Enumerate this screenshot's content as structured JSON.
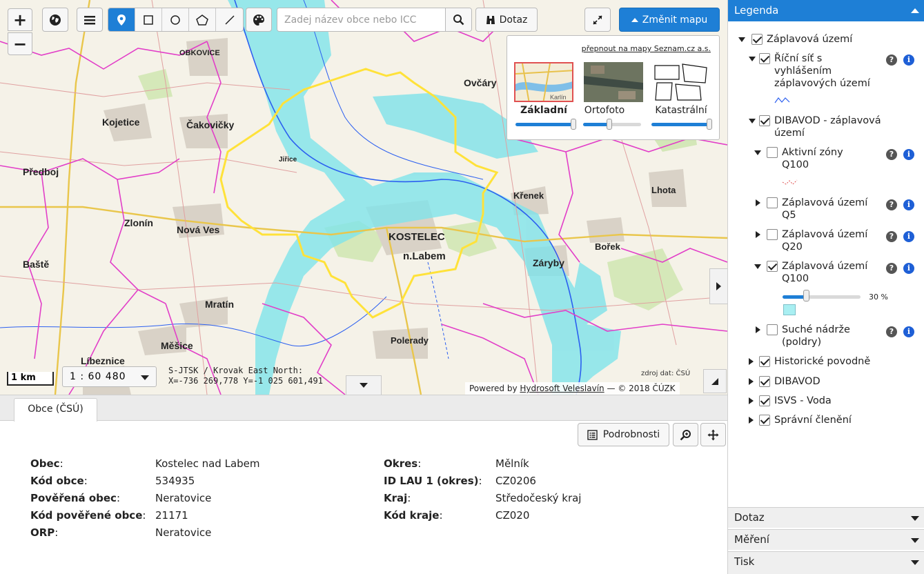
{
  "toolbar": {
    "zoom_in": "+",
    "zoom_out": "−",
    "search_placeholder": "Zadej název obce nebo ICC",
    "dotaz_label": "Dotaz",
    "zmenit_label": "Změnit mapu"
  },
  "basemap": {
    "switch_link": "přepnout na mapy Seznam.cz a.s.",
    "options": [
      {
        "label": "Základní",
        "selected": true,
        "opacity_pct": 100
      },
      {
        "label": "Ortofoto",
        "selected": false,
        "opacity_pct": 45
      },
      {
        "label": "Katastrální",
        "selected": false,
        "opacity_pct": 100
      }
    ],
    "thumb_text": "Karlín"
  },
  "map": {
    "labels": [
      {
        "text": "OBKOVICE"
      },
      {
        "text": "Ovčáry"
      },
      {
        "text": "Kojetice"
      },
      {
        "text": "Čakovičky"
      },
      {
        "text": "Předboj"
      },
      {
        "text": "Zlonín"
      },
      {
        "text": "Nová Ves"
      },
      {
        "text": "KOSTELEC"
      },
      {
        "text": "n.Labem"
      },
      {
        "text": "Křenek"
      },
      {
        "text": "Lhota"
      },
      {
        "text": "Bořek"
      },
      {
        "text": "Záryby"
      },
      {
        "text": "Mratín"
      },
      {
        "text": "Měšice"
      },
      {
        "text": "Polerady"
      },
      {
        "text": "Baště"
      },
      {
        "text": "Líbeznice"
      },
      {
        "text": "Jiřice"
      }
    ],
    "scale_bar": "1 km",
    "scale_value": "1 : 60 480",
    "coord_system": "S-JTSK / Krovak East North:",
    "coord_value": "X=-736 269,778 Y=-1 025 601,491",
    "data_source": "zdroj dat: ČSÚ",
    "attribution_prefix": "Powered by",
    "attribution_link": "Hydrosoft Veleslavín",
    "attribution_suffix": "— © 2018 ČÚZK"
  },
  "bottom": {
    "tab_label": "Obce (ČSÚ)",
    "podrobnosti_label": "Podrobnosti",
    "left_attrs": [
      {
        "key": "Obec",
        "value": "Kostelec nad Labem"
      },
      {
        "key": "Kód obce",
        "value": "534935"
      },
      {
        "key": "Pověřená obec",
        "value": "Neratovice"
      },
      {
        "key": "Kód pověřené obce",
        "value": "21171"
      },
      {
        "key": "ORP",
        "value": "Neratovice"
      }
    ],
    "right_attrs": [
      {
        "key": "Okres",
        "value": "Mělník"
      },
      {
        "key": "ID LAU 1 (okres)",
        "value": "CZ0206"
      },
      {
        "key": "Kraj",
        "value": "Středočeský kraj"
      },
      {
        "key": "Kód kraje",
        "value": "CZ020"
      }
    ]
  },
  "legend": {
    "header": "Legenda",
    "items": [
      {
        "label": "Záplavová území"
      },
      {
        "label_lines": [
          "Říční síť s",
          "vyhlášením",
          "záplavových území"
        ]
      },
      {
        "label_lines": [
          "DIBAVOD - záplavová",
          "území"
        ]
      },
      {
        "label_lines": [
          "Aktivní zóny",
          "Q100"
        ]
      },
      {
        "label_lines": [
          "Záplavová území",
          "Q5"
        ]
      },
      {
        "label_lines": [
          "Záplavová území",
          "Q20"
        ]
      },
      {
        "label_lines": [
          "Záplavová území",
          "Q100"
        ],
        "opacity_pct": 30,
        "opacity_label": "30 %"
      },
      {
        "label_lines": [
          "Suché nádrže",
          "(poldry)"
        ]
      },
      {
        "label": "Historické povodně"
      },
      {
        "label": "DIBAVOD"
      },
      {
        "label": "ISVS - Voda"
      },
      {
        "label": "Správní členění"
      }
    ],
    "accordions": [
      {
        "label": "Dotaz"
      },
      {
        "label": "Měření"
      },
      {
        "label": "Tisk"
      }
    ]
  },
  "colors": {
    "accent": "#1e7fd6",
    "flood_zone": "#7fe3ea",
    "municipal_boundary": "#ffe23a",
    "admin_boundary": "#e23ec8"
  }
}
